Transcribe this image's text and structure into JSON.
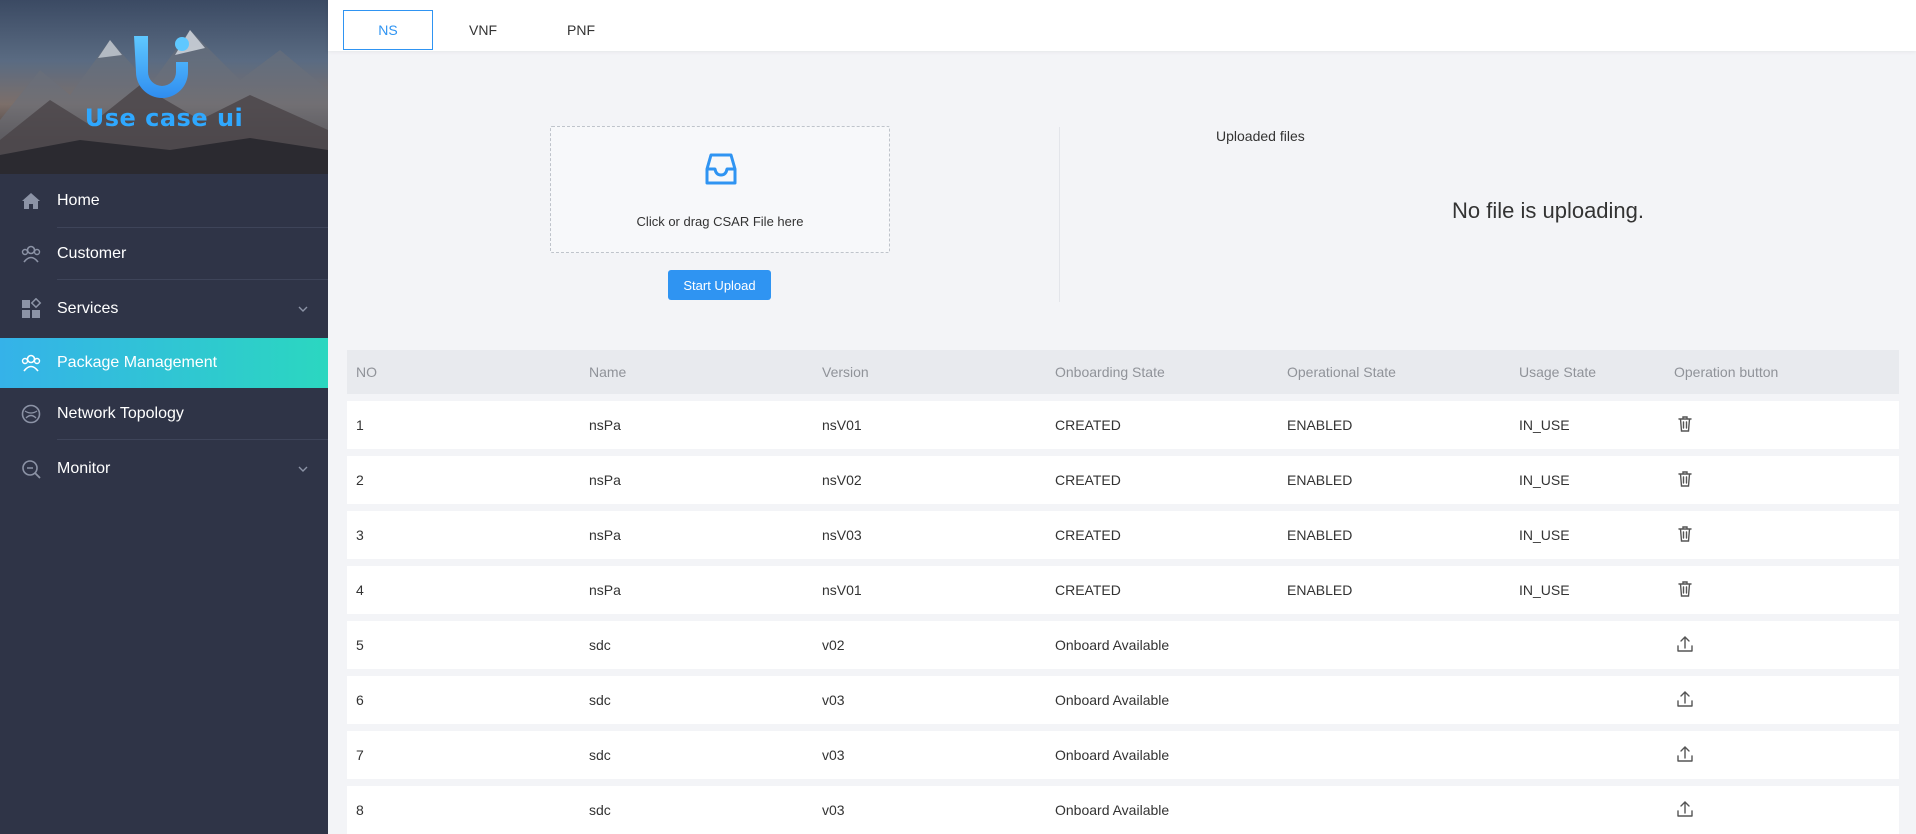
{
  "app": {
    "logo_text": "Use case ui"
  },
  "sidebar": {
    "items": [
      {
        "label": "Home",
        "icon": "home-icon"
      },
      {
        "label": "Customer",
        "icon": "customer-icon"
      },
      {
        "label": "Services",
        "icon": "services-icon",
        "expandable": true
      },
      {
        "label": "Package Management",
        "icon": "package-icon",
        "active": true
      },
      {
        "label": "Network Topology",
        "icon": "topology-icon"
      },
      {
        "label": "Monitor",
        "icon": "monitor-icon",
        "expandable": true
      }
    ]
  },
  "tabs": [
    {
      "label": "NS",
      "active": true
    },
    {
      "label": "VNF"
    },
    {
      "label": "PNF"
    }
  ],
  "upload": {
    "dropzone_text": "Click or drag CSAR File here",
    "button_label": "Start Upload",
    "uploaded_title": "Uploaded files",
    "empty_text": "No file is uploading."
  },
  "table": {
    "columns": [
      "NO",
      "Name",
      "Version",
      "Onboarding State",
      "Operational State",
      "Usage State",
      "Operation button"
    ],
    "rows": [
      {
        "no": "1",
        "name": "nsPa",
        "version": "nsV01",
        "onboarding": "CREATED",
        "operational": "ENABLED",
        "usage": "IN_USE",
        "op": "delete-icon"
      },
      {
        "no": "2",
        "name": "nsPa",
        "version": "nsV02",
        "onboarding": "CREATED",
        "operational": "ENABLED",
        "usage": "IN_USE",
        "op": "delete-icon"
      },
      {
        "no": "3",
        "name": "nsPa",
        "version": "nsV03",
        "onboarding": "CREATED",
        "operational": "ENABLED",
        "usage": "IN_USE",
        "op": "delete-icon"
      },
      {
        "no": "4",
        "name": "nsPa",
        "version": "nsV01",
        "onboarding": "CREATED",
        "operational": "ENABLED",
        "usage": "IN_USE",
        "op": "delete-icon"
      },
      {
        "no": "5",
        "name": "sdc",
        "version": "v02",
        "onboarding": "Onboard Available",
        "operational": "",
        "usage": "",
        "op": "upload-icon"
      },
      {
        "no": "6",
        "name": "sdc",
        "version": "v03",
        "onboarding": "Onboard Available",
        "operational": "",
        "usage": "",
        "op": "upload-icon"
      },
      {
        "no": "7",
        "name": "sdc",
        "version": "v03",
        "onboarding": "Onboard Available",
        "operational": "",
        "usage": "",
        "op": "upload-icon"
      },
      {
        "no": "8",
        "name": "sdc",
        "version": "v03",
        "onboarding": "Onboard Available",
        "operational": "",
        "usage": "",
        "op": "upload-icon"
      }
    ]
  },
  "colors": {
    "accent": "#2f94f2",
    "sidebar_bg": "#2f3447",
    "active_start": "#35b2e9",
    "active_end": "#2bd7c0",
    "logo": "#2fa8ff"
  }
}
